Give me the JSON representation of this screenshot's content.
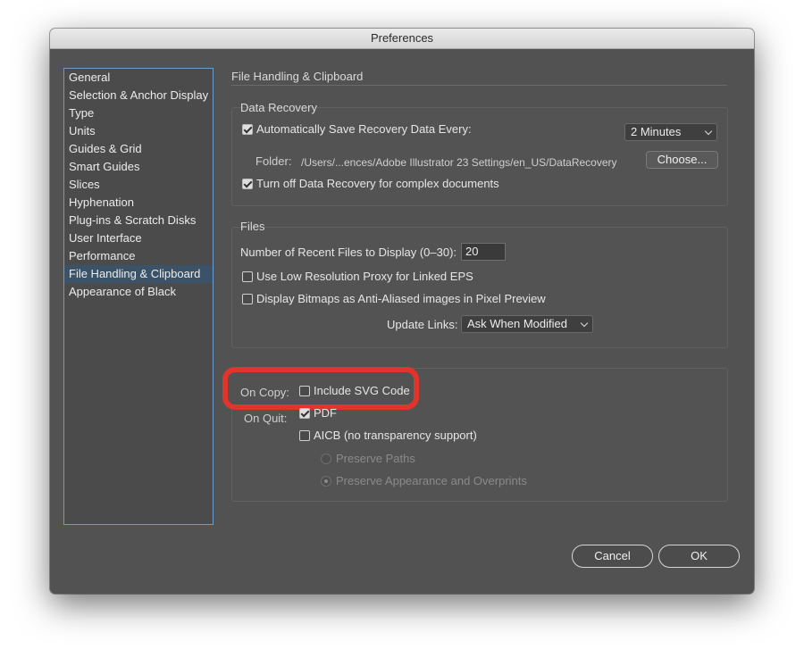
{
  "window": {
    "title": "Preferences"
  },
  "sidebar": {
    "items": [
      {
        "label": "General"
      },
      {
        "label": "Selection & Anchor Display"
      },
      {
        "label": "Type"
      },
      {
        "label": "Units"
      },
      {
        "label": "Guides & Grid"
      },
      {
        "label": "Smart Guides"
      },
      {
        "label": "Slices"
      },
      {
        "label": "Hyphenation"
      },
      {
        "label": "Plug-ins & Scratch Disks"
      },
      {
        "label": "User Interface"
      },
      {
        "label": "Performance"
      },
      {
        "label": "File Handling & Clipboard",
        "selected": true
      },
      {
        "label": "Appearance of Black"
      }
    ]
  },
  "main": {
    "page_title": "File Handling & Clipboard",
    "data_recovery": {
      "title": "Data Recovery",
      "auto_save_label": "Automatically Save Recovery Data Every:",
      "auto_save_checked": true,
      "interval_value": "2 Minutes",
      "folder_label": "Folder:",
      "folder_path": "/Users/...ences/Adobe Illustrator 23 Settings/en_US/DataRecovery",
      "choose_label": "Choose...",
      "complex_docs_label": "Turn off Data Recovery for complex documents",
      "complex_docs_checked": true
    },
    "files": {
      "title": "Files",
      "recent_label": "Number of Recent Files to Display (0–30):",
      "recent_value": "20",
      "low_res_label": "Use Low Resolution Proxy for Linked EPS",
      "low_res_checked": false,
      "bitmaps_label": "Display Bitmaps as Anti-Aliased images in Pixel Preview",
      "bitmaps_checked": false,
      "update_links_label": "Update Links:",
      "update_links_value": "Ask When Modified"
    },
    "clipboard": {
      "on_copy_label": "On Copy:",
      "svg_label": "Include SVG Code",
      "svg_checked": false,
      "on_quit_label": "On Quit:",
      "pdf_label": "PDF",
      "pdf_checked": true,
      "aicb_label": "AICB (no transparency support)",
      "aicb_checked": false,
      "preserve_paths_label": "Preserve Paths",
      "preserve_appearance_label": "Preserve Appearance and Overprints",
      "preserve_appearance_selected": true
    }
  },
  "footer": {
    "cancel_label": "Cancel",
    "ok_label": "OK"
  },
  "colors": {
    "highlight": "#e1342c",
    "window_bg": "#525252",
    "selection": "#3b5368"
  }
}
